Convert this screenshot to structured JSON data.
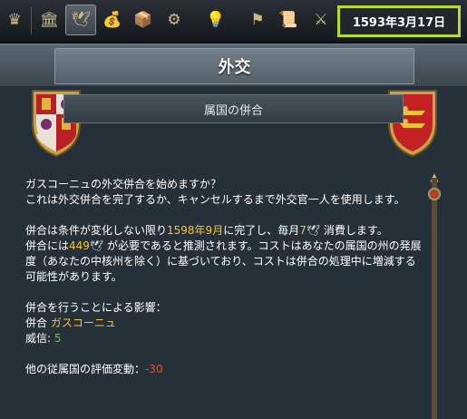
{
  "toolbar": {
    "icons": [
      "crown-icon",
      "government-icon",
      "diplomacy-dove-icon",
      "economy-icon",
      "trade-icon",
      "production-icon",
      "technology-icon",
      "ideas-lightbulb-icon",
      "missions-flag-icon",
      "decisions-scroll-icon",
      "military-icon"
    ],
    "date": "1593年3月17日"
  },
  "window": {
    "title": "外交",
    "subtitle": "属国の併合"
  },
  "body": {
    "line1": "ガスコーニュの外交併合を始めますか？",
    "line2": "これは外交併合を完了するか、キャンセルするまで外交官一人を使用します。",
    "p2_a": "併合は条件が変化しない限り",
    "p2_date": "1598年9月",
    "p2_b": "に完了し、毎月",
    "p2_monthly": "7",
    "p2_c": " 消費します。",
    "p2_d": "併合には",
    "p2_cost": "449",
    "p2_e": " が必要であると推測されます。コストはあなたの属国の州の発展度（あなたの中核州を除く）に基づいており、コストは併合の処理中に増減する可能性があります。",
    "effects_header": "併合を行うことによる影響：",
    "annex_label": "併合 ",
    "annex_target": "ガスコーニュ",
    "prestige_label": "威信: ",
    "prestige_value": "5",
    "opinion_label": "他の従属国の評価変動：",
    "opinion_value": "-30"
  },
  "colors": {
    "highlight_yellow": "#f2c63a",
    "positive_green": "#6cc24a",
    "negative_red": "#e44b3a",
    "date_border": "#b4de2b"
  }
}
